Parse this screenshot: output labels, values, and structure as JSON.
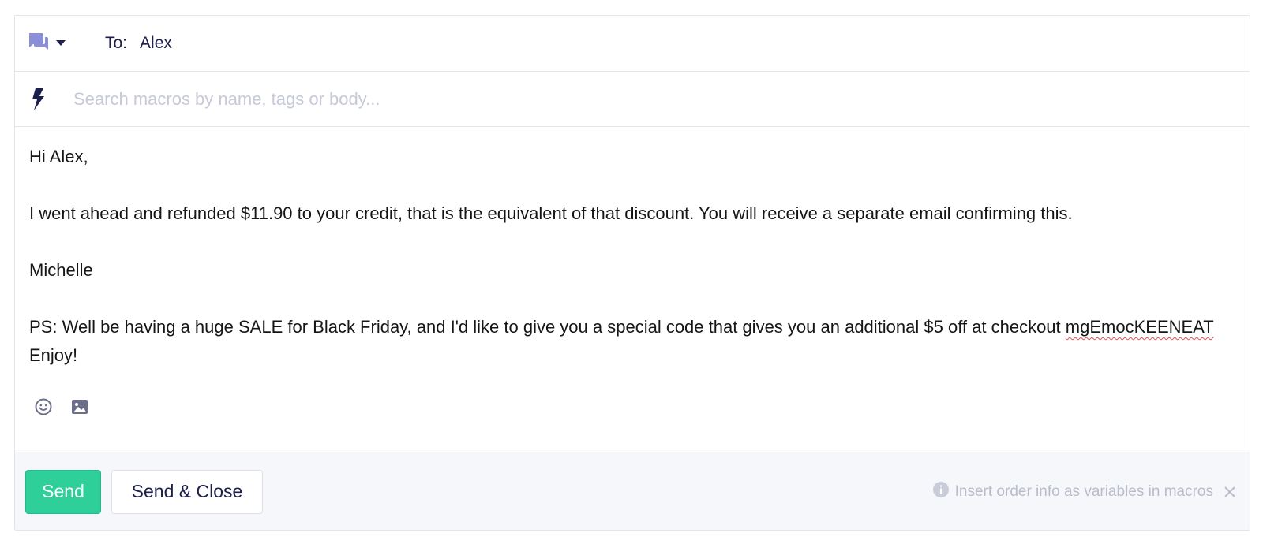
{
  "header": {
    "channel_icon": "chat-bubbles-icon",
    "caret_icon": "caret-down-icon",
    "to_label": "To:",
    "to_value": "Alex"
  },
  "macros": {
    "icon": "lightning-bolt-icon",
    "placeholder": "Search macros by name, tags or body..."
  },
  "message": {
    "greeting": "Hi Alex,",
    "paragraph1": "I went ahead and refunded $11.90 to your credit, that is the equivalent of that discount. You will receive a separate email confirming this.",
    "signature": "Michelle",
    "ps_text": "PS: Well be having a huge SALE for Black Friday, and I'd like to give you a special code that gives you an additional $5 off at checkout",
    "ps_code": "mgEmocKEENEAT",
    "ps_end": "Enjoy!"
  },
  "toolbar": {
    "emoji_icon": "emoji-smile-icon",
    "image_icon": "image-icon"
  },
  "footer": {
    "send_label": "Send",
    "send_close_label": "Send & Close",
    "hint_text": "Insert order info as variables in macros",
    "hint_icon": "info-icon",
    "dismiss_icon": "close-icon"
  },
  "colors": {
    "accent": "#2ecf98",
    "primary_text": "#1d1f4d",
    "icon_purple": "#8b8fd8",
    "muted": "#b9bccb"
  }
}
